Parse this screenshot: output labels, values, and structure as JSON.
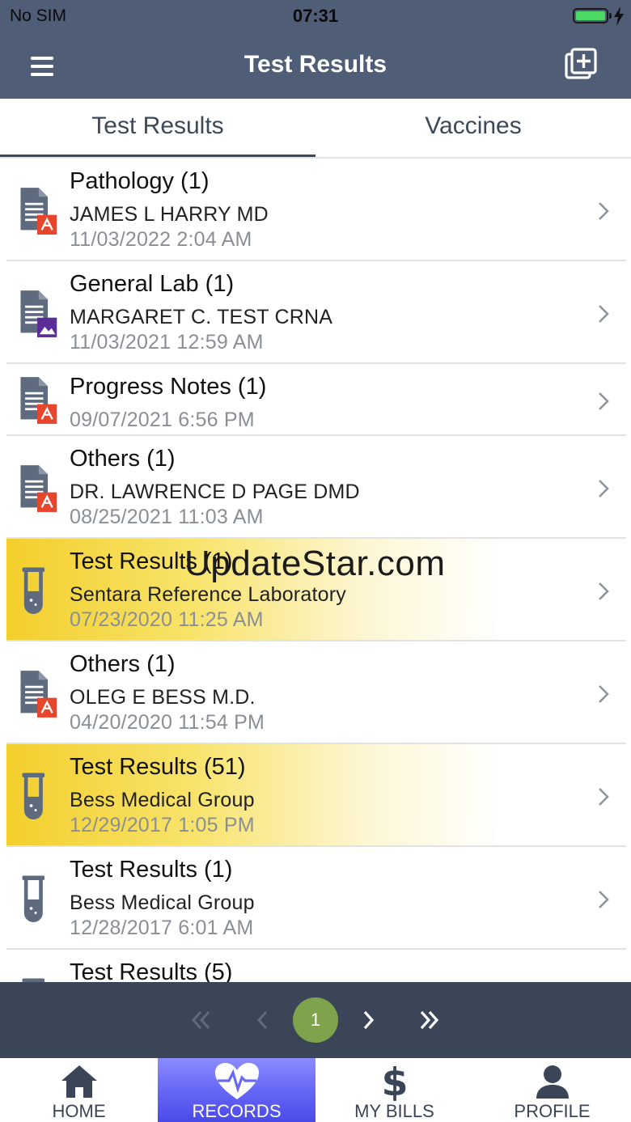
{
  "status": {
    "carrier": "No SIM",
    "time": "07:31",
    "battery_level": 1.0,
    "battery_color": "#4cd964"
  },
  "header": {
    "title": "Test Results",
    "menu_icon": "hamburger-menu-icon",
    "add_icon": "add-record-icon",
    "background": "#4f5d76"
  },
  "tabs": [
    {
      "label": "Test Results",
      "active": true
    },
    {
      "label": "Vaccines",
      "active": false
    }
  ],
  "results": [
    {
      "title": "Pathology (1)",
      "subtitle": "JAMES L HARRY MD",
      "date": "11/03/2022 2:04 AM",
      "icon": "pdf-document-icon",
      "highlighted": false
    },
    {
      "title": "General Lab (1)",
      "subtitle": "MARGARET C. TEST CRNA",
      "date": "11/03/2021 12:59 AM",
      "icon": "image-document-icon",
      "highlighted": false
    },
    {
      "title": "Progress Notes (1)",
      "subtitle": "",
      "date": "09/07/2021 6:56 PM",
      "icon": "pdf-document-icon",
      "highlighted": false
    },
    {
      "title": "Others (1)",
      "subtitle": "DR. LAWRENCE D PAGE DMD",
      "date": "08/25/2021 11:03 AM",
      "icon": "pdf-document-icon",
      "highlighted": false
    },
    {
      "title": "Test Results (1)",
      "subtitle": "Sentara Reference Laboratory",
      "date": "07/23/2020 11:25 AM",
      "icon": "test-tube-icon",
      "highlighted": true
    },
    {
      "title": "Others (1)",
      "subtitle": "OLEG E BESS M.D.",
      "date": "04/20/2020 11:54 PM",
      "icon": "pdf-document-icon",
      "highlighted": false
    },
    {
      "title": "Test Results (51)",
      "subtitle": "Bess Medical Group",
      "date": "12/29/2017 1:05 PM",
      "icon": "test-tube-icon",
      "highlighted": true
    },
    {
      "title": "Test Results (1)",
      "subtitle": "Bess Medical Group",
      "date": "12/28/2017 6:01 AM",
      "icon": "test-tube-icon",
      "highlighted": false
    },
    {
      "title": "Test Results (5)",
      "subtitle": "",
      "date": "",
      "icon": "test-tube-icon",
      "highlighted": false
    }
  ],
  "watermark": "UpdateStar.com",
  "pagination": {
    "current_page": "1",
    "first_icon": "double-chevron-left-icon",
    "prev_icon": "chevron-left-icon",
    "next_icon": "chevron-right-icon",
    "last_icon": "double-chevron-right-icon",
    "active_color": "#7fa34d"
  },
  "bottom_nav": [
    {
      "label": "HOME",
      "icon": "home-icon",
      "active": false
    },
    {
      "label": "RECORDS",
      "icon": "heart-pulse-icon",
      "active": true
    },
    {
      "label": "MY BILLS",
      "icon": "dollar-icon",
      "active": false
    },
    {
      "label": "PROFILE",
      "icon": "person-icon",
      "active": false
    }
  ]
}
